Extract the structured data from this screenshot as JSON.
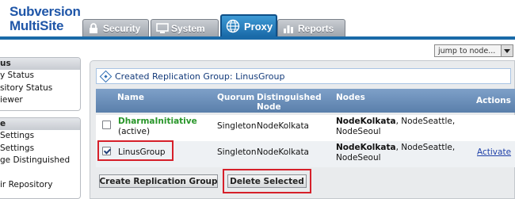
{
  "app": {
    "logo_line1": "Subversion",
    "logo_line2": "MultiSite"
  },
  "tabs": [
    {
      "label": "Security",
      "icon": "lock-icon",
      "active": false
    },
    {
      "label": "System",
      "icon": "monitor-icon",
      "active": false
    },
    {
      "label": "Proxy",
      "icon": "globe-icon",
      "active": true
    },
    {
      "label": "Reports",
      "icon": "bar-chart-icon",
      "active": false
    }
  ],
  "jump": {
    "value": "jump to node..."
  },
  "sidebar": {
    "section1": {
      "heading": "us",
      "items": [
        "y Status",
        "sitory Status",
        "iewer"
      ]
    },
    "section2": {
      "heading": "e",
      "items": [
        "Settings",
        "Settings",
        "ge Distinguished",
        "",
        "ir Repository"
      ]
    }
  },
  "notice": {
    "text": "Created Replication Group: LinusGroup"
  },
  "table": {
    "headers": {
      "name": "Name",
      "quorum": "Quorum",
      "distinguished_1": "Distinguished",
      "distinguished_2": "Node",
      "nodes": "Nodes",
      "actions": "Actions"
    },
    "rows": [
      {
        "checked": false,
        "name": "DharmaInitiative",
        "subtext": "(active)",
        "quorum": "Singleton",
        "distinguished": "NodeKolkata",
        "nodes_bold": "NodeKolkata",
        "nodes_rest": ", NodeSeattle,",
        "nodes_line2": "NodeSeoul",
        "action": ""
      },
      {
        "checked": true,
        "name": "LinusGroup",
        "quorum": "Singleton",
        "distinguished": "NodeKolkata",
        "nodes_bold": "NodeKolkata",
        "nodes_rest": ", NodeSeattle,",
        "nodes_line2": "NodeSeoul",
        "action": "Activate"
      }
    ]
  },
  "buttons": {
    "create": "Create Replication Group",
    "delete": "Delete Selected"
  },
  "colors": {
    "brand": "#1f56a8",
    "active_tab": "#1a6aa8",
    "highlight": "#d6202a",
    "active_name": "#29962a",
    "table_header": "#5a7fab"
  }
}
